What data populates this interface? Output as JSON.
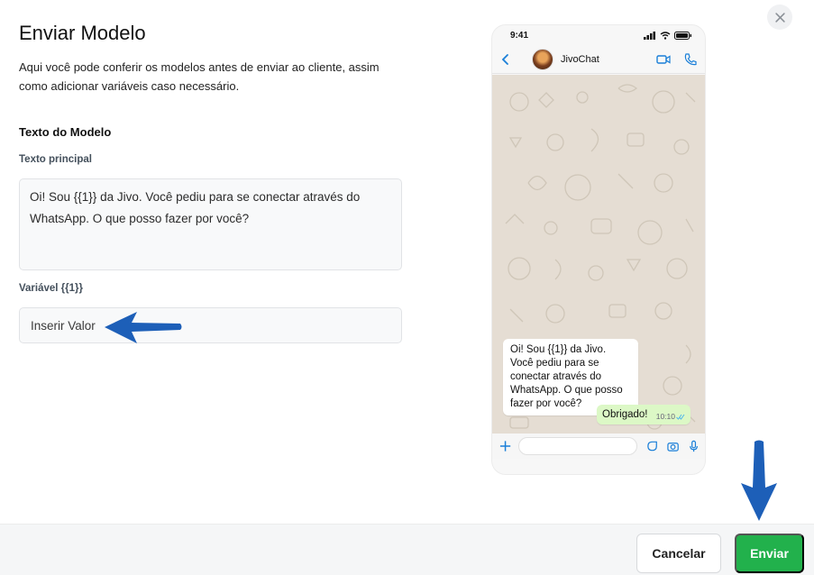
{
  "modal": {
    "title": "Enviar Modelo",
    "description": "Aqui você pode conferir os modelos antes de enviar ao cliente, assim como adicionar variáveis caso necessário.",
    "section_title": "Texto do Modelo",
    "main_text_label": "Texto principal",
    "main_text_value": "Oi! Sou {{1}} da Jivo. Você pediu para se conectar através do WhatsApp. O que posso fazer por você?",
    "variable_label": "Variável {{1}}",
    "variable_placeholder": "Inserir Valor"
  },
  "preview": {
    "status_time": "9:41",
    "chat_name": "JivoChat",
    "incoming_message": "Oi! Sou {{1}} da Jivo. Você pediu para se conectar através do WhatsApp. O que posso fazer por você?",
    "outgoing_message": "Obrigado!",
    "outgoing_time": "10:10"
  },
  "footer": {
    "cancel_label": "Cancelar",
    "send_label": "Enviar"
  },
  "colors": {
    "send_button": "#22b14c",
    "annotation_arrow": "#1d5fb8",
    "chat_background": "#e5ddd3",
    "outgoing_bubble": "#dcf8c6",
    "whatsapp_blue": "#1a7fd8"
  },
  "icons": [
    "close-icon",
    "back-icon",
    "video-call-icon",
    "phone-icon",
    "plus-icon",
    "sticker-icon",
    "camera-icon",
    "microphone-icon",
    "double-check-icon",
    "signal-icon",
    "wifi-icon",
    "battery-icon"
  ]
}
